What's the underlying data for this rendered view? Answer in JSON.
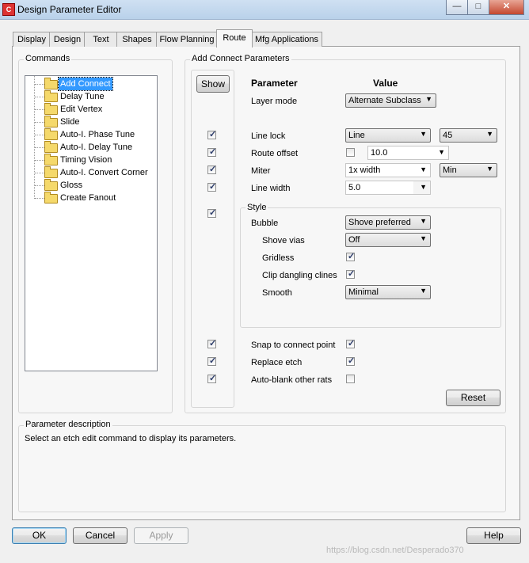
{
  "window": {
    "title": "Design Parameter Editor",
    "icon_glyph": "C",
    "minimize_glyph": "—",
    "maximize_glyph": "□",
    "close_glyph": "✕"
  },
  "tabs": [
    "Display",
    "Design",
    "Text",
    "Shapes",
    "Flow Planning",
    "Route",
    "Mfg Applications"
  ],
  "active_tab": "Route",
  "commands": {
    "label": "Commands",
    "items": [
      "Add Connect",
      "Delay Tune",
      "Edit Vertex",
      "Slide",
      "Auto-I. Phase Tune",
      "Auto-I. Delay Tune",
      "Timing Vision",
      "Auto-I. Convert Corner",
      "Gloss",
      "Create Fanout"
    ],
    "selected": "Add Connect"
  },
  "params": {
    "group_label": "Add Connect Parameters",
    "show_button": "Show",
    "header_parameter": "Parameter",
    "header_value": "Value",
    "layer_mode": {
      "label": "Layer mode",
      "value": "Alternate Subclass"
    },
    "line_lock": {
      "label": "Line lock",
      "value": "Line",
      "angle": "45",
      "show": true
    },
    "route_offset": {
      "label": "Route offset",
      "checked": false,
      "value": "10.0",
      "show": true
    },
    "miter": {
      "label": "Miter",
      "value": "1x width",
      "mode": "Min",
      "show": true
    },
    "line_width": {
      "label": "Line width",
      "value": "5.0",
      "show": true
    },
    "style": {
      "label": "Style",
      "show": true,
      "bubble": {
        "label": "Bubble",
        "value": "Shove preferred"
      },
      "shove_vias": {
        "label": "Shove vias",
        "value": "Off"
      },
      "gridless": {
        "label": "Gridless",
        "checked": true
      },
      "clip_dangling": {
        "label": "Clip dangling clines",
        "checked": true
      },
      "smooth": {
        "label": "Smooth",
        "value": "Minimal"
      }
    },
    "snap": {
      "label": "Snap to connect point",
      "checked": true,
      "show": true
    },
    "replace_etch": {
      "label": "Replace etch",
      "checked": true,
      "show": true
    },
    "auto_blank": {
      "label": "Auto-blank other rats",
      "checked": false,
      "show": true
    },
    "reset_button": "Reset"
  },
  "description": {
    "label": "Parameter description",
    "text": "Select an etch edit command to display its parameters."
  },
  "footer": {
    "ok": "OK",
    "cancel": "Cancel",
    "apply": "Apply",
    "help": "Help",
    "watermark": "https://blog.csdn.net/Desperado370"
  },
  "colors": {
    "selection": "#3399ff",
    "folder": "#f5d96b",
    "window_bg": "#f0f0f0"
  }
}
